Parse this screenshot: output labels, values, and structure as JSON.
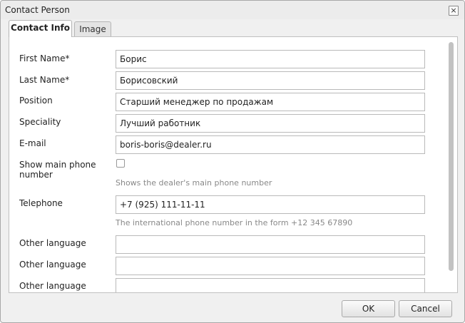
{
  "dialog": {
    "title": "Contact Person",
    "close_glyph": "×"
  },
  "tabs": [
    {
      "label": "Contact Info",
      "active": true
    },
    {
      "label": "Image",
      "active": false
    }
  ],
  "form": {
    "first_name": {
      "label": "First Name*",
      "value": "Борис"
    },
    "last_name": {
      "label": "Last Name*",
      "value": "Борисовский"
    },
    "position": {
      "label": "Position",
      "value": "Старший менеджер по продажам"
    },
    "speciality": {
      "label": "Speciality",
      "value": "Лучший работник"
    },
    "email": {
      "label": "E-mail",
      "value": "boris-boris@dealer.ru"
    },
    "show_main_phone": {
      "label_line1": "Show main phone",
      "label_line2": "number",
      "checked": false,
      "hint": "Shows the dealer's main phone number"
    },
    "telephone": {
      "label": "Telephone",
      "value": "+7 (925) 111-11-11",
      "hint": "The international phone number in the form +12 345 67890"
    },
    "other_languages": [
      {
        "label": "Other language",
        "value": ""
      },
      {
        "label": "Other language",
        "value": ""
      },
      {
        "label": "Other language",
        "value": ""
      }
    ]
  },
  "buttons": {
    "ok": "OK",
    "cancel": "Cancel"
  },
  "colors": {
    "panel_background": "#ffffff",
    "dialog_background": "#f0f0f0",
    "hint_text": "#888888",
    "scrollbar_thumb": "#c2c2c2"
  }
}
